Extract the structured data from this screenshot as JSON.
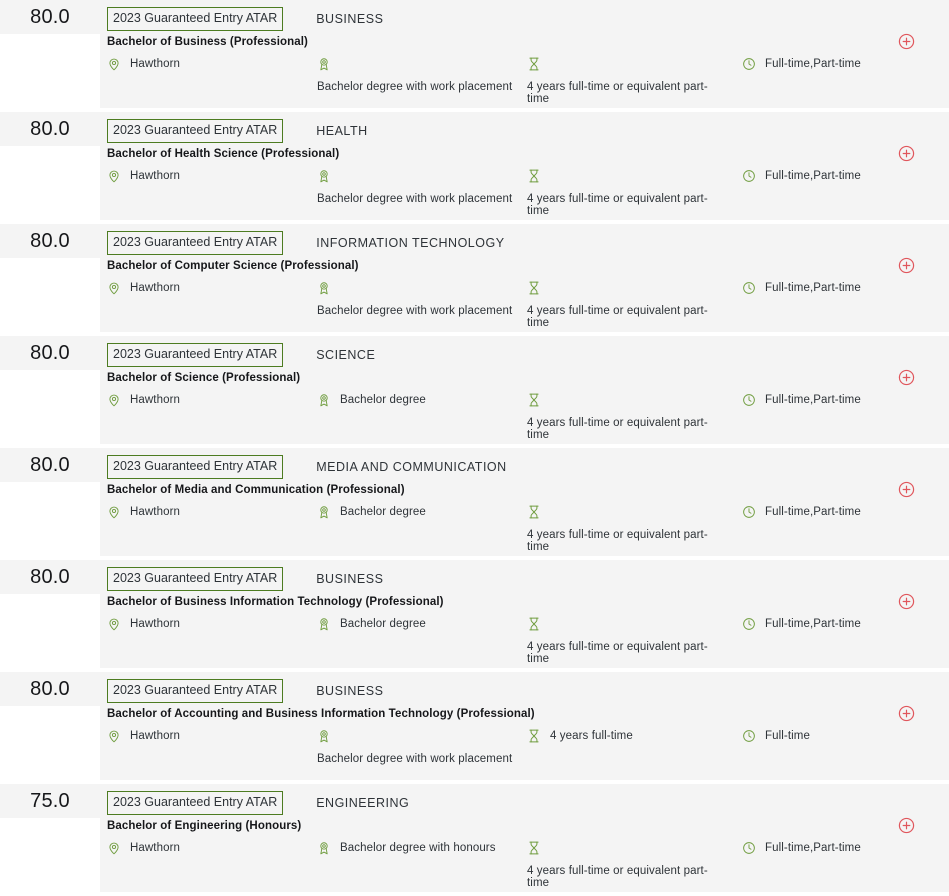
{
  "list": {
    "name": "course-results",
    "icons": {
      "location": "location-pin-icon",
      "level": "award-medal-icon",
      "duration": "hourglass-icon",
      "mode": "clock-icon",
      "add": "add-circle-icon"
    },
    "colors": {
      "icon_green": "#6f9c3e",
      "badge_border": "#4d7c21",
      "add_red": "#e0565c",
      "row_background": "#f4f4f4",
      "score_chip_background": "#f4f4f4",
      "text_primary": "#16171a",
      "text_secondary": "#2e3338"
    },
    "rows": [
      {
        "score": "80.0",
        "badge": "2023 Guaranteed Entry ATAR",
        "category": "BUSINESS",
        "title": "Bachelor of Business (Professional)",
        "location": "Hawthorn",
        "level": "Bachelor degree with work placement",
        "level_wrap": true,
        "duration": "4 years full-time or equivalent part-time",
        "duration_wrap": true,
        "mode": "Full-time,Part-time",
        "add_label": "Add to shortlist"
      },
      {
        "score": "80.0",
        "badge": "2023 Guaranteed Entry ATAR",
        "category": "HEALTH",
        "title": "Bachelor of Health Science (Professional)",
        "location": "Hawthorn",
        "level": "Bachelor degree with work placement",
        "level_wrap": true,
        "duration": "4 years full-time or equivalent part-time",
        "duration_wrap": true,
        "mode": "Full-time,Part-time",
        "add_label": "Add to shortlist"
      },
      {
        "score": "80.0",
        "badge": "2023 Guaranteed Entry ATAR",
        "category": "INFORMATION TECHNOLOGY",
        "title": "Bachelor of Computer Science (Professional)",
        "location": "Hawthorn",
        "level": "Bachelor degree with work placement",
        "level_wrap": true,
        "duration": "4 years full-time or equivalent part-time",
        "duration_wrap": true,
        "mode": "Full-time,Part-time",
        "add_label": "Add to shortlist"
      },
      {
        "score": "80.0",
        "badge": "2023 Guaranteed Entry ATAR",
        "category": "SCIENCE",
        "title": "Bachelor of Science (Professional)",
        "location": "Hawthorn",
        "level": "Bachelor degree",
        "level_wrap": false,
        "duration": "4 years full-time or equivalent part-time",
        "duration_wrap": true,
        "mode": "Full-time,Part-time",
        "add_label": "Add to shortlist"
      },
      {
        "score": "80.0",
        "badge": "2023 Guaranteed Entry ATAR",
        "category": "MEDIA AND COMMUNICATION",
        "title": "Bachelor of Media and Communication (Professional)",
        "location": "Hawthorn",
        "level": "Bachelor degree",
        "level_wrap": false,
        "duration": "4 years full-time or equivalent part-time",
        "duration_wrap": true,
        "mode": "Full-time,Part-time",
        "add_label": "Add to shortlist"
      },
      {
        "score": "80.0",
        "badge": "2023 Guaranteed Entry ATAR",
        "category": "BUSINESS",
        "title": "Bachelor of Business Information Technology (Professional)",
        "location": "Hawthorn",
        "level": "Bachelor degree",
        "level_wrap": false,
        "duration": "4 years full-time or equivalent part-time",
        "duration_wrap": true,
        "mode": "Full-time,Part-time",
        "add_label": "Add to shortlist"
      },
      {
        "score": "80.0",
        "badge": "2023 Guaranteed Entry ATAR",
        "category": "BUSINESS",
        "title": "Bachelor of Accounting and Business Information Technology (Professional)",
        "location": "Hawthorn",
        "level": "Bachelor degree with work placement",
        "level_wrap": true,
        "duration": "4 years full-time",
        "duration_wrap": false,
        "mode": "Full-time",
        "add_label": "Add to shortlist"
      },
      {
        "score": "75.0",
        "badge": "2023 Guaranteed Entry ATAR",
        "category": "ENGINEERING",
        "title": "Bachelor of Engineering (Honours)",
        "location": "Hawthorn",
        "level": "Bachelor degree with honours",
        "level_wrap": false,
        "duration": "4 years full-time or equivalent part-time",
        "duration_wrap": true,
        "mode": "Full-time,Part-time",
        "add_label": "Add to shortlist"
      }
    ]
  }
}
